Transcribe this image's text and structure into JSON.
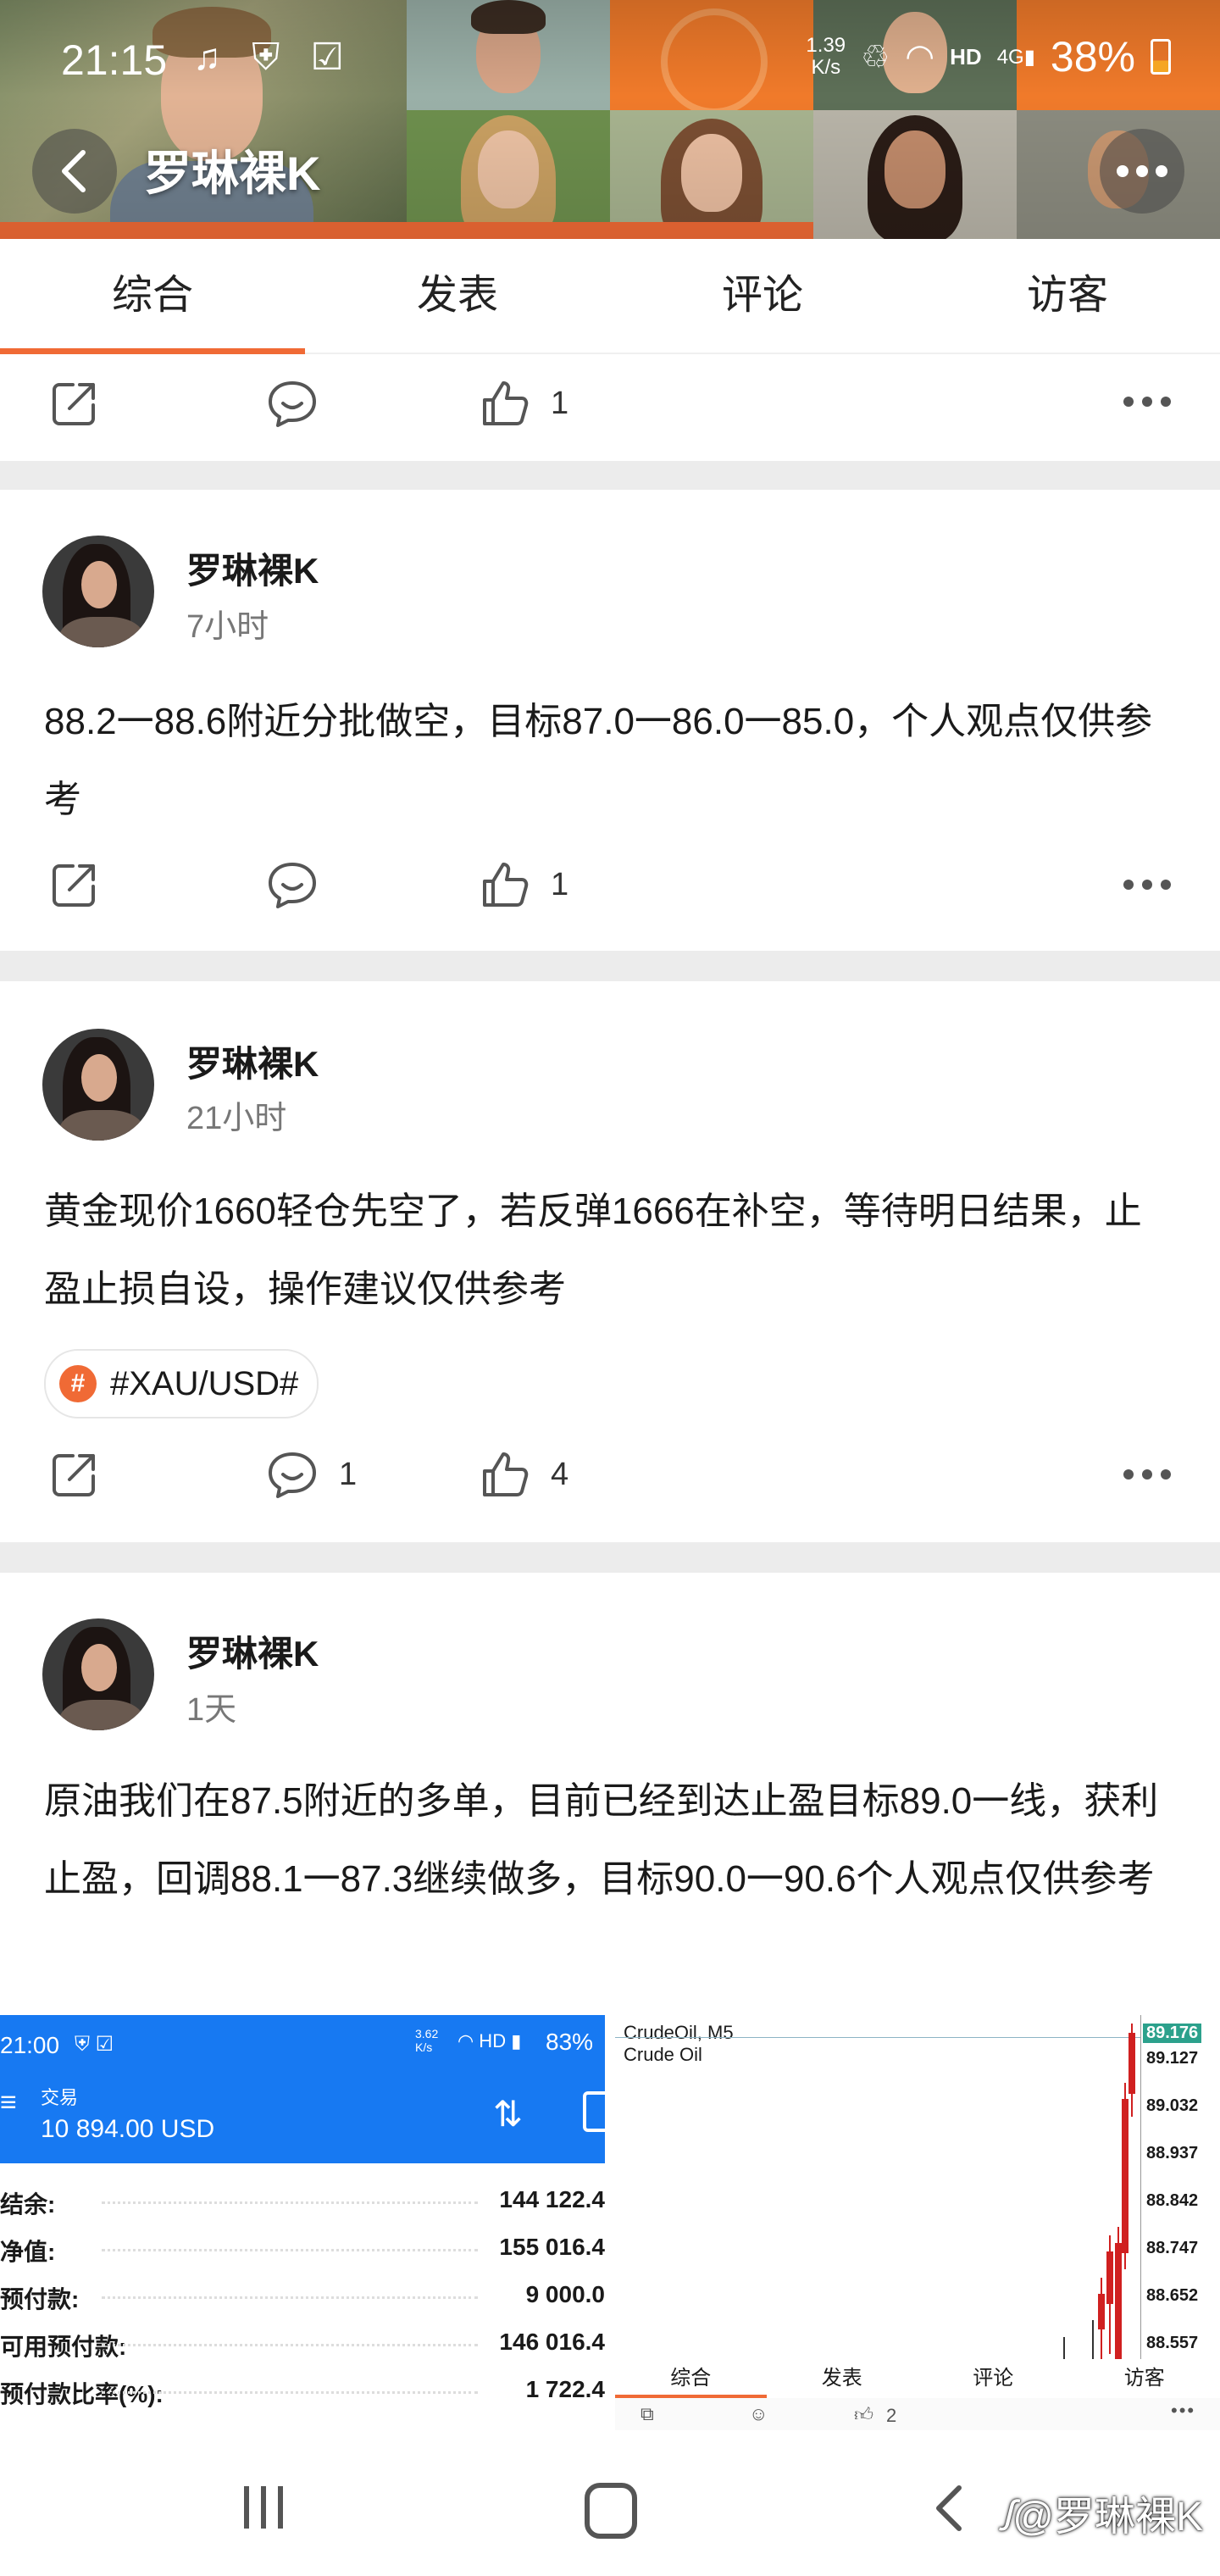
{
  "status_bar": {
    "time": "21:15",
    "net_speed_top": "1.39",
    "net_speed_bottom": "K/s",
    "hd": "HD",
    "net_type": "4G",
    "battery": "38%"
  },
  "header": {
    "name": "罗琳裸K"
  },
  "tabs": [
    {
      "label": "综合"
    },
    {
      "label": "发表"
    },
    {
      "label": "评论"
    },
    {
      "label": "访客"
    }
  ],
  "prev_post_actions": {
    "comments": "",
    "likes": "1"
  },
  "posts": [
    {
      "author": "罗琳裸K",
      "time": "7小时",
      "text": "88.2一88.6附近分批做空，目标87.0一86.0一85.0，个人观点仅供参考",
      "comments": "",
      "likes": "1"
    },
    {
      "author": "罗琳裸K",
      "time": "21小时",
      "text": "黄金现价1660轻仓先空了，若反弹1666在补空，等待明日结果，止盈止损自设，操作建议仅供参考",
      "tag": "#XAU/USD#",
      "comments": "1",
      "likes": "4"
    },
    {
      "author": "罗琳裸K",
      "time": "1天",
      "text": "原油我们在87.5附近的多单，目前已经到达止盈目标89.0一线，获利止盈，回调88.1一87.3继续做多，目标90.0一90.6个人观点仅供参考"
    }
  ],
  "shot_trade": {
    "time": "21:00",
    "speed": "3.62 K/s",
    "battery": "83%",
    "title": "交易",
    "balance": "10 894.00 USD",
    "rows": [
      {
        "k": "结余:",
        "v": "144 122.4"
      },
      {
        "k": "净值:",
        "v": "155 016.4"
      },
      {
        "k": "预付款:",
        "v": "9 000.0"
      },
      {
        "k": "可用预付款:",
        "v": "146 016.4"
      },
      {
        "k": "预付款比率(%):",
        "v": "1 722.4"
      }
    ]
  },
  "shot_chart": {
    "symbol": "CrudeOil, M5",
    "name": "Crude Oil",
    "prices": [
      "89.176",
      "89.127",
      "89.032",
      "88.937",
      "88.842",
      "88.747",
      "88.652",
      "88.557"
    ],
    "tabs": [
      "综合",
      "发表",
      "评论",
      "访客"
    ],
    "likes": "2"
  },
  "watermark": "@罗琳裸K",
  "colors": {
    "accent": "#f06a35",
    "trade_blue": "#1779f2"
  }
}
